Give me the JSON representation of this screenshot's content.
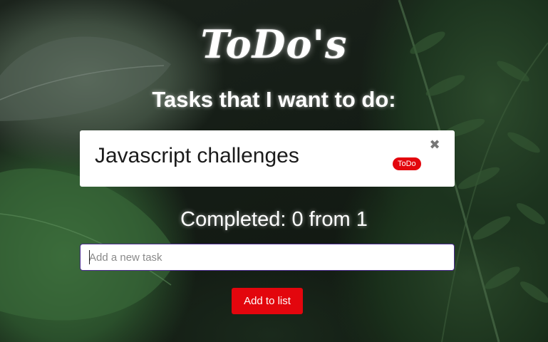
{
  "app": {
    "title": "ToDo's",
    "subtitle": "Tasks that I want to do:"
  },
  "tasks": [
    {
      "text": "Javascript challenges",
      "badge": "ToDo",
      "close_glyph": "✖"
    }
  ],
  "progress": {
    "completed_label": "Completed: 0 from 1"
  },
  "new_task": {
    "value": "",
    "placeholder": "Add a new task"
  },
  "add_button": {
    "label": "Add to list"
  },
  "colors": {
    "accent_red": "#e3060d",
    "input_border": "#4b2c8f",
    "card_bg": "#ffffff"
  },
  "icons": {
    "remove_task": "close-icon"
  }
}
